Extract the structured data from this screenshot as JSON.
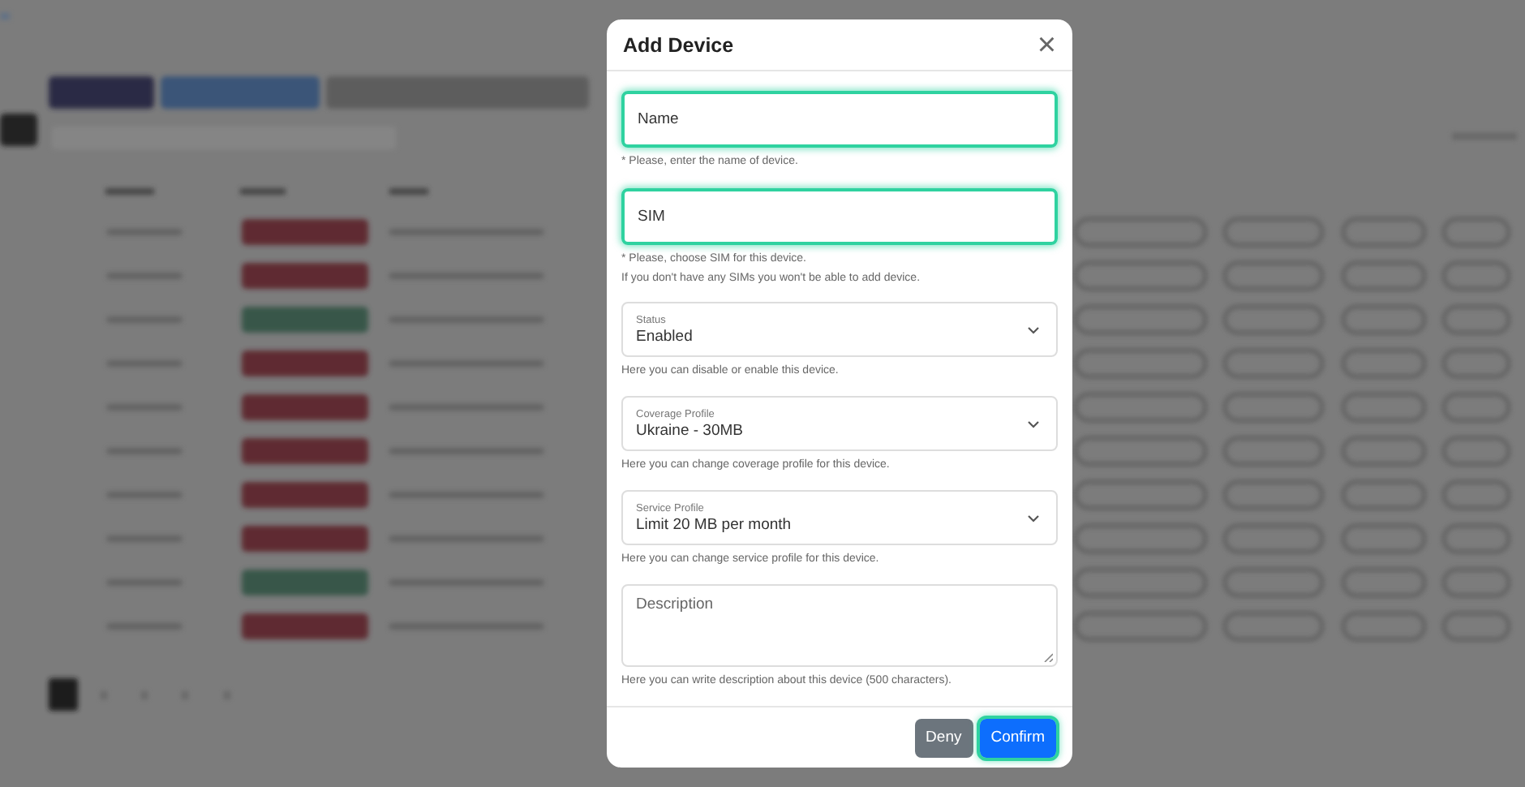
{
  "dialog": {
    "title": "Add Device",
    "close": "×",
    "fields": [
      {
        "kind": "input",
        "label": "Name",
        "highlighted": true,
        "hints": [
          "* Please, enter the name of device."
        ]
      },
      {
        "kind": "input",
        "label": "SIM",
        "highlighted": true,
        "hints": [
          "* Please, choose SIM for this device.",
          "If you don't have any SIMs you won't be able to add device."
        ]
      },
      {
        "kind": "select",
        "label": "Status",
        "value": "Enabled",
        "highlighted": false,
        "hints": [
          "Here you can disable or enable this device."
        ]
      },
      {
        "kind": "select",
        "label": "Coverage Profile",
        "value": "Ukraine - 30MB",
        "highlighted": false,
        "hints": [
          "Here you can change coverage profile for this device."
        ]
      },
      {
        "kind": "select",
        "label": "Service Profile",
        "value": "Limit 20 MB per month",
        "highlighted": false,
        "hints": [
          "Here you can change service profile for this device."
        ]
      },
      {
        "kind": "textarea",
        "label": "Description",
        "highlighted": false,
        "hints": [
          "Here you can write description about this device (500 characters)."
        ]
      }
    ],
    "buttons": [
      {
        "kind": "secondary",
        "label": "Deny",
        "highlighted": false
      },
      {
        "kind": "primary",
        "label": "Confirm",
        "highlighted": true
      }
    ]
  }
}
